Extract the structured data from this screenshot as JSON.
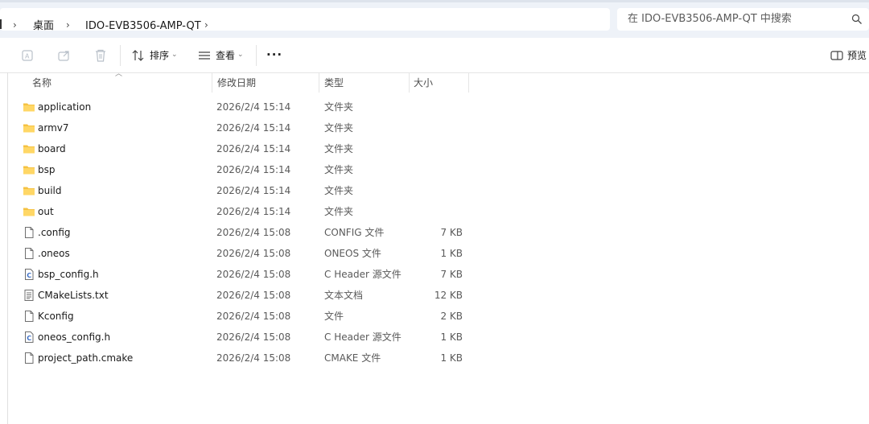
{
  "address_bar": {
    "breadcrumbs": [
      "桌面",
      "IDO-EVB3506-AMP-QT"
    ]
  },
  "search": {
    "placeholder": "在 IDO-EVB3506-AMP-QT 中搜索"
  },
  "toolbar": {
    "sort_label": "排序",
    "view_label": "查看",
    "preview_label": "预览"
  },
  "columns": [
    "名称",
    "修改日期",
    "类型",
    "大小"
  ],
  "files": [
    {
      "name": "application",
      "date": "2026/2/4 15:14",
      "type": "文件夹",
      "size": "",
      "icon": "folder-icon"
    },
    {
      "name": "armv7",
      "date": "2026/2/4 15:14",
      "type": "文件夹",
      "size": "",
      "icon": "folder-icon"
    },
    {
      "name": "board",
      "date": "2026/2/4 15:14",
      "type": "文件夹",
      "size": "",
      "icon": "folder-icon"
    },
    {
      "name": "bsp",
      "date": "2026/2/4 15:14",
      "type": "文件夹",
      "size": "",
      "icon": "folder-icon"
    },
    {
      "name": "build",
      "date": "2026/2/4 15:14",
      "type": "文件夹",
      "size": "",
      "icon": "folder-icon"
    },
    {
      "name": "out",
      "date": "2026/2/4 15:14",
      "type": "文件夹",
      "size": "",
      "icon": "folder-icon"
    },
    {
      "name": ".config",
      "date": "2026/2/4 15:08",
      "type": "CONFIG 文件",
      "size": "7 KB",
      "icon": "file-icon"
    },
    {
      "name": ".oneos",
      "date": "2026/2/4 15:08",
      "type": "ONEOS 文件",
      "size": "1 KB",
      "icon": "file-icon"
    },
    {
      "name": "bsp_config.h",
      "date": "2026/2/4 15:08",
      "type": "C Header 源文件",
      "size": "7 KB",
      "icon": "c-header-icon"
    },
    {
      "name": "CMakeLists.txt",
      "date": "2026/2/4 15:08",
      "type": "文本文档",
      "size": "12 KB",
      "icon": "text-file-icon"
    },
    {
      "name": "Kconfig",
      "date": "2026/2/4 15:08",
      "type": "文件",
      "size": "2 KB",
      "icon": "file-icon"
    },
    {
      "name": "oneos_config.h",
      "date": "2026/2/4 15:08",
      "type": "C Header 源文件",
      "size": "1 KB",
      "icon": "c-header-icon"
    },
    {
      "name": "project_path.cmake",
      "date": "2026/2/4 15:08",
      "type": "CMAKE 文件",
      "size": "1 KB",
      "icon": "file-icon"
    }
  ],
  "colors": {
    "folder": "#F5C242",
    "address_band": "#EEF2F8",
    "accent": "#3B6EC7"
  }
}
